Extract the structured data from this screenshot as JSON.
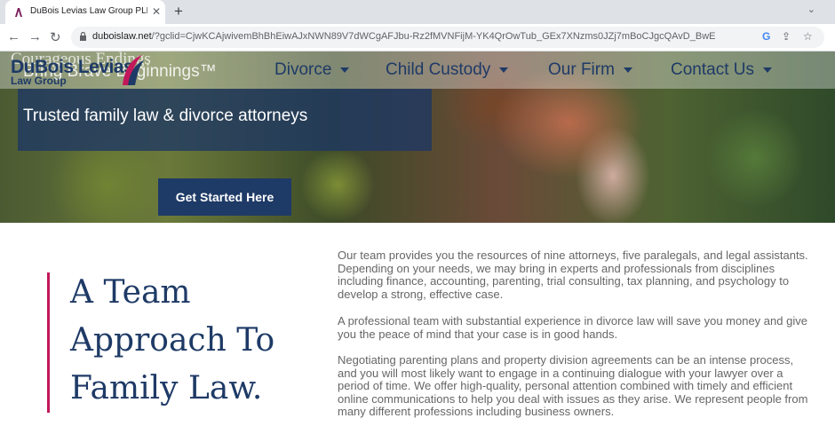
{
  "browser": {
    "tab_title": "DuBois Levias Law Group PLLC | D",
    "url_domain": "duboislaw.net",
    "url_path": "/?gclid=CjwKCAjwivemBhBhEiwAJxNWN89V7dWCgAFJbu-Rz2fMVNFijM-YK4QrOwTub_GEx7XNzms0JZj7mBoCJgcQAvD_BwE",
    "google_glyph": "G"
  },
  "site": {
    "logo": {
      "name": "DuBois Levias",
      "sub": "Law Group",
      "overlay_line1": "Courageous Endings",
      "overlay_line2": "Bring Brave Beginnings™"
    },
    "nav": [
      "Divorce",
      "Child Custody",
      "Our Firm",
      "Contact Us"
    ],
    "hero": {
      "tagline": "Trusted family law & divorce attorneys",
      "cta": "Get Started Here"
    },
    "section": {
      "heading_lines": [
        "A Team",
        "Approach To",
        "Family Law."
      ],
      "paragraphs": [
        "Our team provides you the resources of nine attorneys, five paralegals, and legal assistants. Depending on your needs, we may bring in experts and professionals from disciplines including finance, accounting, parenting, trial consulting, tax planning, and psychology to develop a strong, effective case.",
        "A professional team with substantial experience in divorce law will save you money and give you the peace of mind that your case is in good hands.",
        "Negotiating parenting plans and property division agreements can be an intense process, and you will most likely want to engage in a continuing dialogue with your lawyer over a period of time. We offer high-quality, personal attention combined with timely and efficient online communications to help you deal with issues as they arise. We represent people from many different professions including business owners."
      ]
    }
  },
  "colors": {
    "brand_navy": "#1e3a66",
    "accent_magenta": "#c2185b",
    "body_text": "#666666"
  }
}
